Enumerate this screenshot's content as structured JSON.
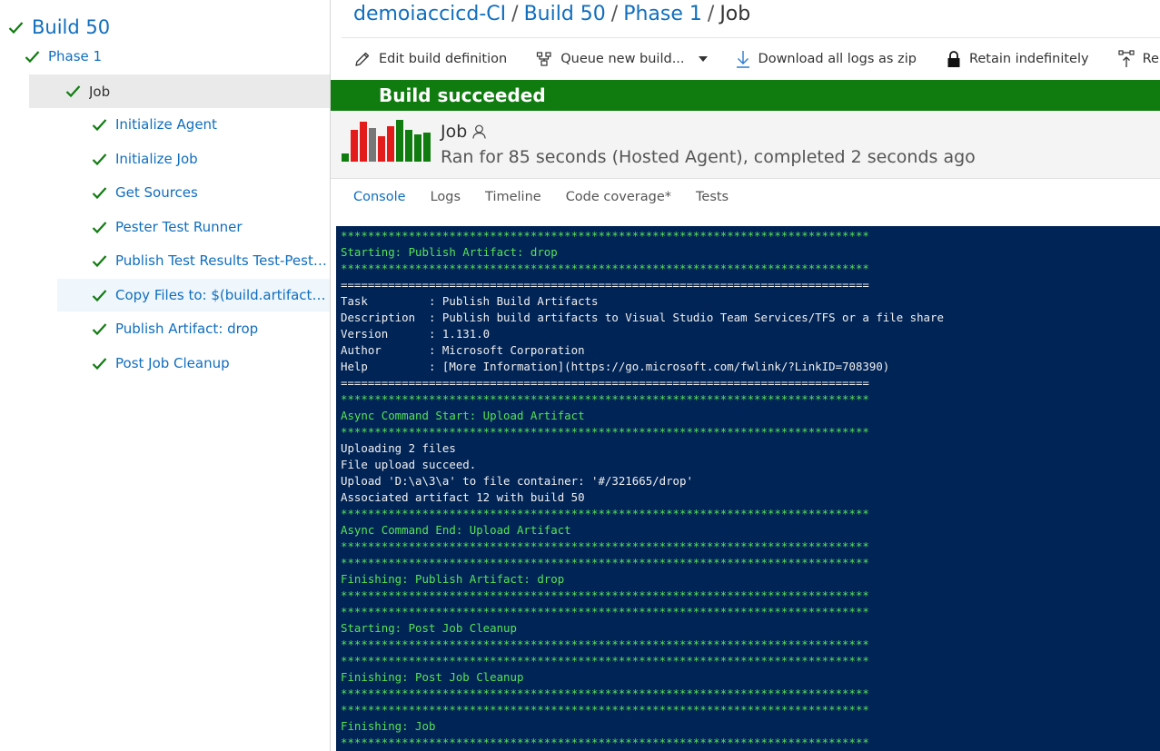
{
  "tree": [
    {
      "label": "Build 50",
      "indent": 0,
      "size": 21,
      "state": "normal"
    },
    {
      "label": "Phase 1",
      "indent": 1,
      "size": 15,
      "state": "normal"
    },
    {
      "label": "Job",
      "indent": 2,
      "size": 15,
      "state": "selected"
    },
    {
      "label": "Initialize Agent",
      "indent": 3,
      "size": 15,
      "state": "normal"
    },
    {
      "label": "Initialize Job",
      "indent": 3,
      "size": 15,
      "state": "normal"
    },
    {
      "label": "Get Sources",
      "indent": 3,
      "size": 15,
      "state": "normal"
    },
    {
      "label": "Pester Test Runner",
      "indent": 3,
      "size": 15,
      "state": "normal"
    },
    {
      "label": "Publish Test Results Test-Pester....",
      "indent": 3,
      "size": 15,
      "state": "normal"
    },
    {
      "label": "Copy Files to: $(build.artifactst...",
      "indent": 3,
      "size": 15,
      "state": "hover"
    },
    {
      "label": "Publish Artifact: drop",
      "indent": 3,
      "size": 15,
      "state": "normal"
    },
    {
      "label": "Post Job Cleanup",
      "indent": 3,
      "size": 15,
      "state": "normal"
    }
  ],
  "breadcrumb": {
    "items": [
      "demoiaccicd-CI",
      "Build 50",
      "Phase 1"
    ],
    "separator": "/",
    "current": "Job"
  },
  "toolbar": {
    "edit": "Edit build definition",
    "queue": "Queue new build...",
    "download": "Download all logs as zip",
    "retain": "Retain indefinitely",
    "release": "Release"
  },
  "banner": "Build succeeded",
  "job": {
    "title": "Job",
    "status": "Ran for 85 seconds (Hosted Agent), completed 2 seconds ago",
    "history_bars": [
      {
        "value": 0.2,
        "status": "succeeded"
      },
      {
        "value": 0.75,
        "status": "failed"
      },
      {
        "value": 0.95,
        "status": "failed"
      },
      {
        "value": 0.8,
        "status": "canceled"
      },
      {
        "value": 0.6,
        "status": "failed"
      },
      {
        "value": 0.85,
        "status": "failed"
      },
      {
        "value": 1.0,
        "status": "succeeded"
      },
      {
        "value": 0.75,
        "status": "succeeded"
      },
      {
        "value": 0.65,
        "status": "succeeded"
      },
      {
        "value": 0.7,
        "status": "succeeded"
      }
    ]
  },
  "tabs": [
    "Console",
    "Logs",
    "Timeline",
    "Code coverage*",
    "Tests"
  ],
  "active_tab": "Console",
  "colors": {
    "link": "#106ebe",
    "success": "#107c10",
    "failed": "#e31b1b",
    "canceled": "#777777",
    "console_bg": "#012456",
    "console_green": "#56e356"
  },
  "console_lines": [
    {
      "t": "******************************************************************************",
      "c": "green"
    },
    {
      "t": "Starting: Publish Artifact: drop",
      "c": "green"
    },
    {
      "t": "******************************************************************************",
      "c": "green"
    },
    {
      "t": "==============================================================================",
      "c": "white"
    },
    {
      "t": "Task         : Publish Build Artifacts",
      "c": "white"
    },
    {
      "t": "Description  : Publish build artifacts to Visual Studio Team Services/TFS or a file share",
      "c": "white"
    },
    {
      "t": "Version      : 1.131.0",
      "c": "white"
    },
    {
      "t": "Author       : Microsoft Corporation",
      "c": "white"
    },
    {
      "t": "Help         : [More Information](https://go.microsoft.com/fwlink/?LinkID=708390)",
      "c": "white"
    },
    {
      "t": "==============================================================================",
      "c": "white"
    },
    {
      "t": "******************************************************************************",
      "c": "green"
    },
    {
      "t": "Async Command Start: Upload Artifact",
      "c": "green"
    },
    {
      "t": "******************************************************************************",
      "c": "green"
    },
    {
      "t": "Uploading 2 files",
      "c": "white"
    },
    {
      "t": "File upload succeed.",
      "c": "white"
    },
    {
      "t": "Upload 'D:\\a\\3\\a' to file container: '#/321665/drop'",
      "c": "white"
    },
    {
      "t": "Associated artifact 12 with build 50",
      "c": "white"
    },
    {
      "t": "******************************************************************************",
      "c": "green"
    },
    {
      "t": "Async Command End: Upload Artifact",
      "c": "green"
    },
    {
      "t": "******************************************************************************",
      "c": "green"
    },
    {
      "t": "******************************************************************************",
      "c": "green"
    },
    {
      "t": "Finishing: Publish Artifact: drop",
      "c": "green"
    },
    {
      "t": "******************************************************************************",
      "c": "green"
    },
    {
      "t": "******************************************************************************",
      "c": "green"
    },
    {
      "t": "Starting: Post Job Cleanup",
      "c": "green"
    },
    {
      "t": "******************************************************************************",
      "c": "green"
    },
    {
      "t": "******************************************************************************",
      "c": "green"
    },
    {
      "t": "Finishing: Post Job Cleanup",
      "c": "green"
    },
    {
      "t": "******************************************************************************",
      "c": "green"
    },
    {
      "t": "******************************************************************************",
      "c": "green"
    },
    {
      "t": "Finishing: Job",
      "c": "green"
    },
    {
      "t": "******************************************************************************",
      "c": "green"
    }
  ]
}
